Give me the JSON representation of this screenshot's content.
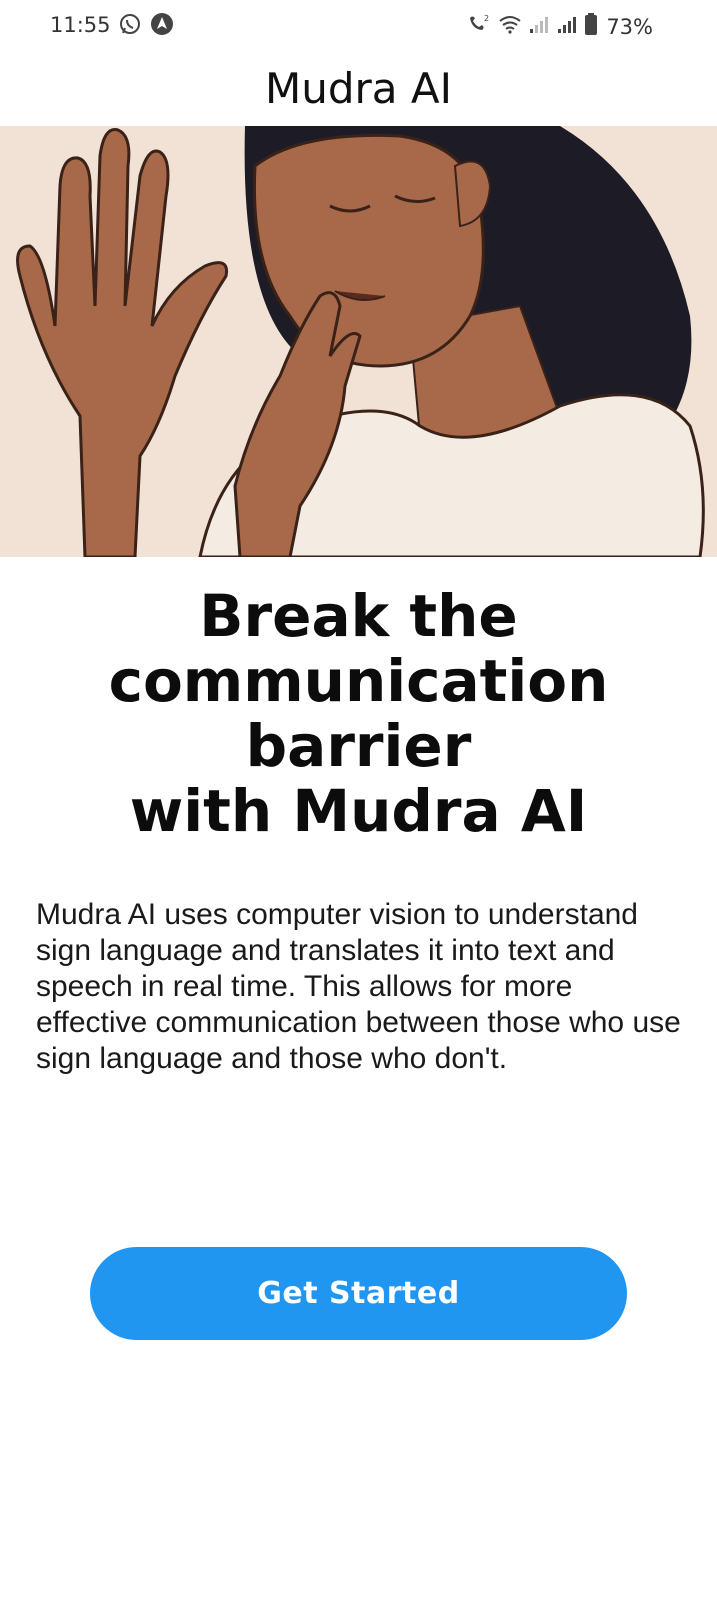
{
  "status_bar": {
    "time": "11:55",
    "battery": "73%",
    "icons_left": [
      "whatsapp-icon",
      "navigation-icon"
    ],
    "icons_right": [
      "wifi-call-icon",
      "wifi-icon",
      "signal-weak-icon",
      "signal-icon",
      "battery-icon"
    ]
  },
  "app": {
    "title": "Mudra AI"
  },
  "hero": {
    "image": "illustration-woman-sign-language"
  },
  "headline": {
    "lines": [
      "Break the",
      "communication",
      "barrier",
      "with Mudra AI"
    ]
  },
  "description": "Mudra AI uses computer vision to understand sign language and translates it into text and speech in real time. This allows for more effective communication between those who use sign language and those who don't.",
  "cta": {
    "label": "Get Started",
    "color": "#2196f0"
  },
  "colors": {
    "hero_background": "#f1e2d5",
    "skin": "#a8694a",
    "hair": "#1d1b26",
    "shirt": "#f4ebe2"
  }
}
